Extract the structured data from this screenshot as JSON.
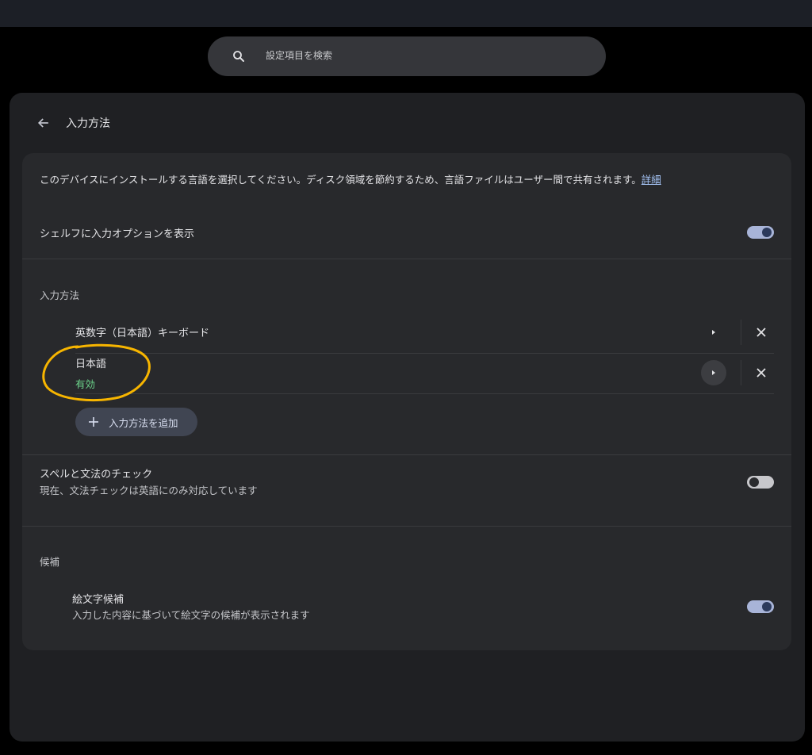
{
  "search": {
    "placeholder": "設定項目を検索"
  },
  "header": {
    "title": "入力方法"
  },
  "description": {
    "text": "このデバイスにインストールする言語を選択してください。ディスク領域を節約するため、言語ファイルはユーザー間で共有されます。",
    "link": "詳細"
  },
  "shelf_option": {
    "label": "シェルフに入力オプションを表示",
    "enabled": true
  },
  "input_methods": {
    "section_title": "入力方法",
    "items": [
      {
        "name": "英数字（日本語）キーボード",
        "status": ""
      },
      {
        "name": "日本語",
        "status": "有効"
      }
    ],
    "add_label": "入力方法を追加"
  },
  "spell_check": {
    "label": "スペルと文法のチェック",
    "sublabel": "現在、文法チェックは英語にのみ対応しています",
    "enabled": false
  },
  "suggestions": {
    "section_title": "候補",
    "emoji": {
      "label": "絵文字候補",
      "sublabel": "入力した内容に基づいて絵文字の候補が表示されます",
      "enabled": true
    }
  },
  "colors": {
    "accent": "#a8c7fa",
    "enabled_text": "#6dd58c",
    "annotation": "#f7b500"
  },
  "icons": [
    "search-icon",
    "back-arrow-icon",
    "chevron-right-icon",
    "close-icon",
    "plus-icon"
  ]
}
